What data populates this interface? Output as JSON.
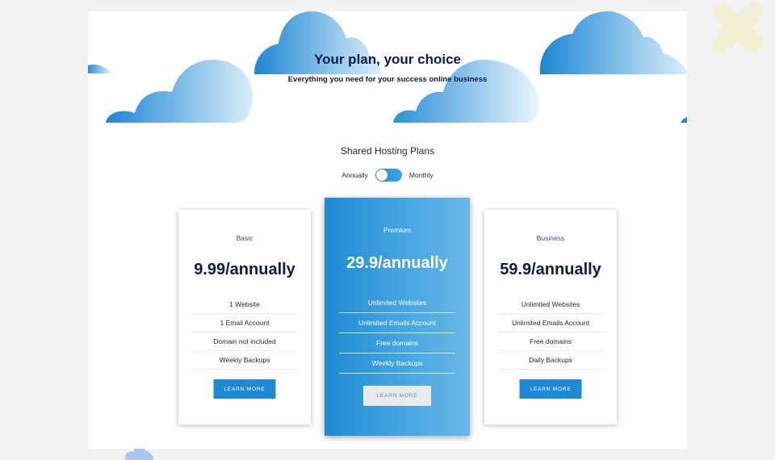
{
  "hero": {
    "title": "Your plan, your choice",
    "subtitle": "Everything you need for your success online business"
  },
  "section_title": "Shared Hosting Plans",
  "billing_toggle": {
    "left_label": "Annually",
    "right_label": "Monthly",
    "selected": "Annually"
  },
  "plans": [
    {
      "name": "Basic",
      "price": "9.99/annually",
      "features": [
        "1 Website",
        "1 Email Account",
        "Domain not included",
        "Weekly Backups"
      ],
      "button": "LEARN MORE"
    },
    {
      "name": "Premium",
      "price": "29.9/annually",
      "features": [
        "Unlimited Websites",
        "Unlimited Emails Account",
        "Free domains",
        "Weekly Backups"
      ],
      "button": "LEARN MORE",
      "highlighted": true
    },
    {
      "name": "Business",
      "price": "59.9/annually",
      "features": [
        "Unlimited Websites",
        "Unlimited Emails Account",
        "Free domains",
        "Daily Backups"
      ],
      "button": "LEARN MORE"
    }
  ],
  "colors": {
    "accent": "#1e8ad6",
    "heading": "#0b1b4a",
    "page_background": "#f2f2f2"
  }
}
